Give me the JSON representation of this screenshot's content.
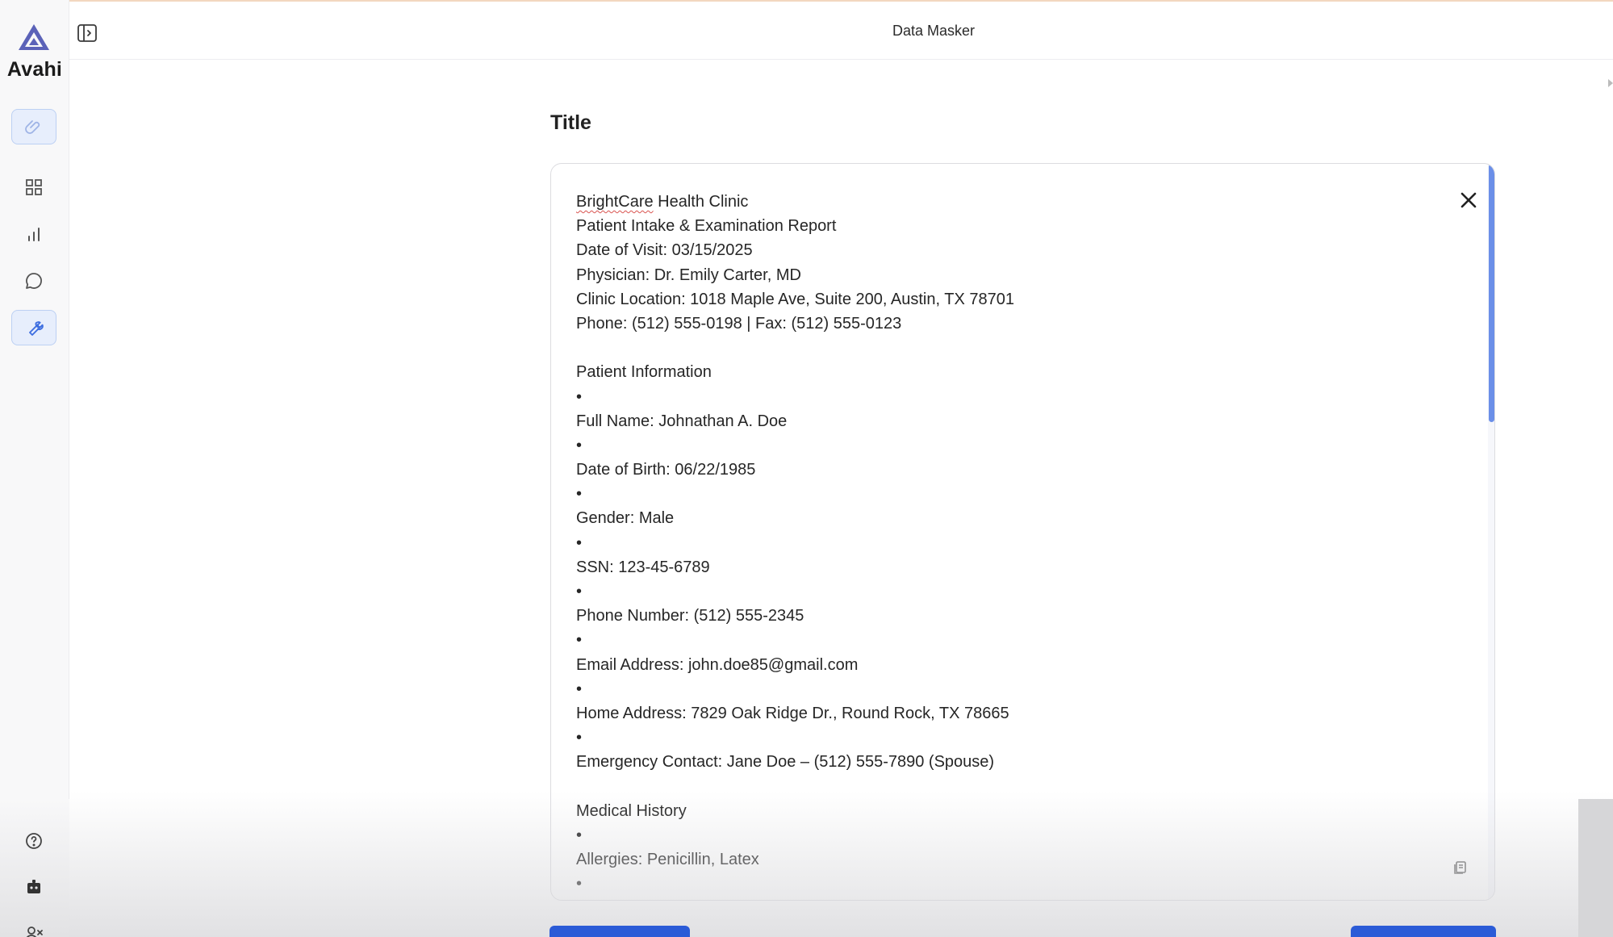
{
  "app": {
    "name": "Avahi",
    "page_title": "Data Masker",
    "accent_color": "#2b5bd7"
  },
  "sidebar": {
    "items": [
      {
        "name": "attachment-icon",
        "active": true
      },
      {
        "name": "grid-icon",
        "active": false
      },
      {
        "name": "bar-chart-icon",
        "active": false
      },
      {
        "name": "chat-icon",
        "active": false
      },
      {
        "name": "wrench-icon",
        "active": true
      }
    ],
    "bottom_items": [
      {
        "name": "help-icon"
      },
      {
        "name": "robot-icon"
      },
      {
        "name": "user-x-icon"
      }
    ]
  },
  "main": {
    "section_title": "Title",
    "document_lines": [
      "BrightCare Health Clinic",
      "Patient Intake & Examination Report",
      "Date of Visit: 03/15/2025",
      "Physician: Dr. Emily Carter, MD",
      "Clinic Location: 1018 Maple Ave, Suite 200, Austin, TX 78701",
      "Phone: (512) 555-0198 | Fax: (512) 555-0123",
      "",
      "Patient Information",
      "•",
      "Full Name: Johnathan A. Doe",
      "•",
      "Date of Birth: 06/22/1985",
      "•",
      "Gender: Male",
      "•",
      "SSN: 123-45-6789",
      "•",
      "Phone Number: (512) 555-2345",
      "•",
      "Email Address: john.doe85@gmail.com",
      "•",
      "Home Address: 7829 Oak Ridge Dr., Round Rock, TX 78665",
      "•",
      "Emergency Contact: Jane Doe – (512) 555-7890 (Spouse)",
      "",
      "Medical History",
      "•",
      "Allergies: Penicillin, Latex",
      "•"
    ]
  }
}
